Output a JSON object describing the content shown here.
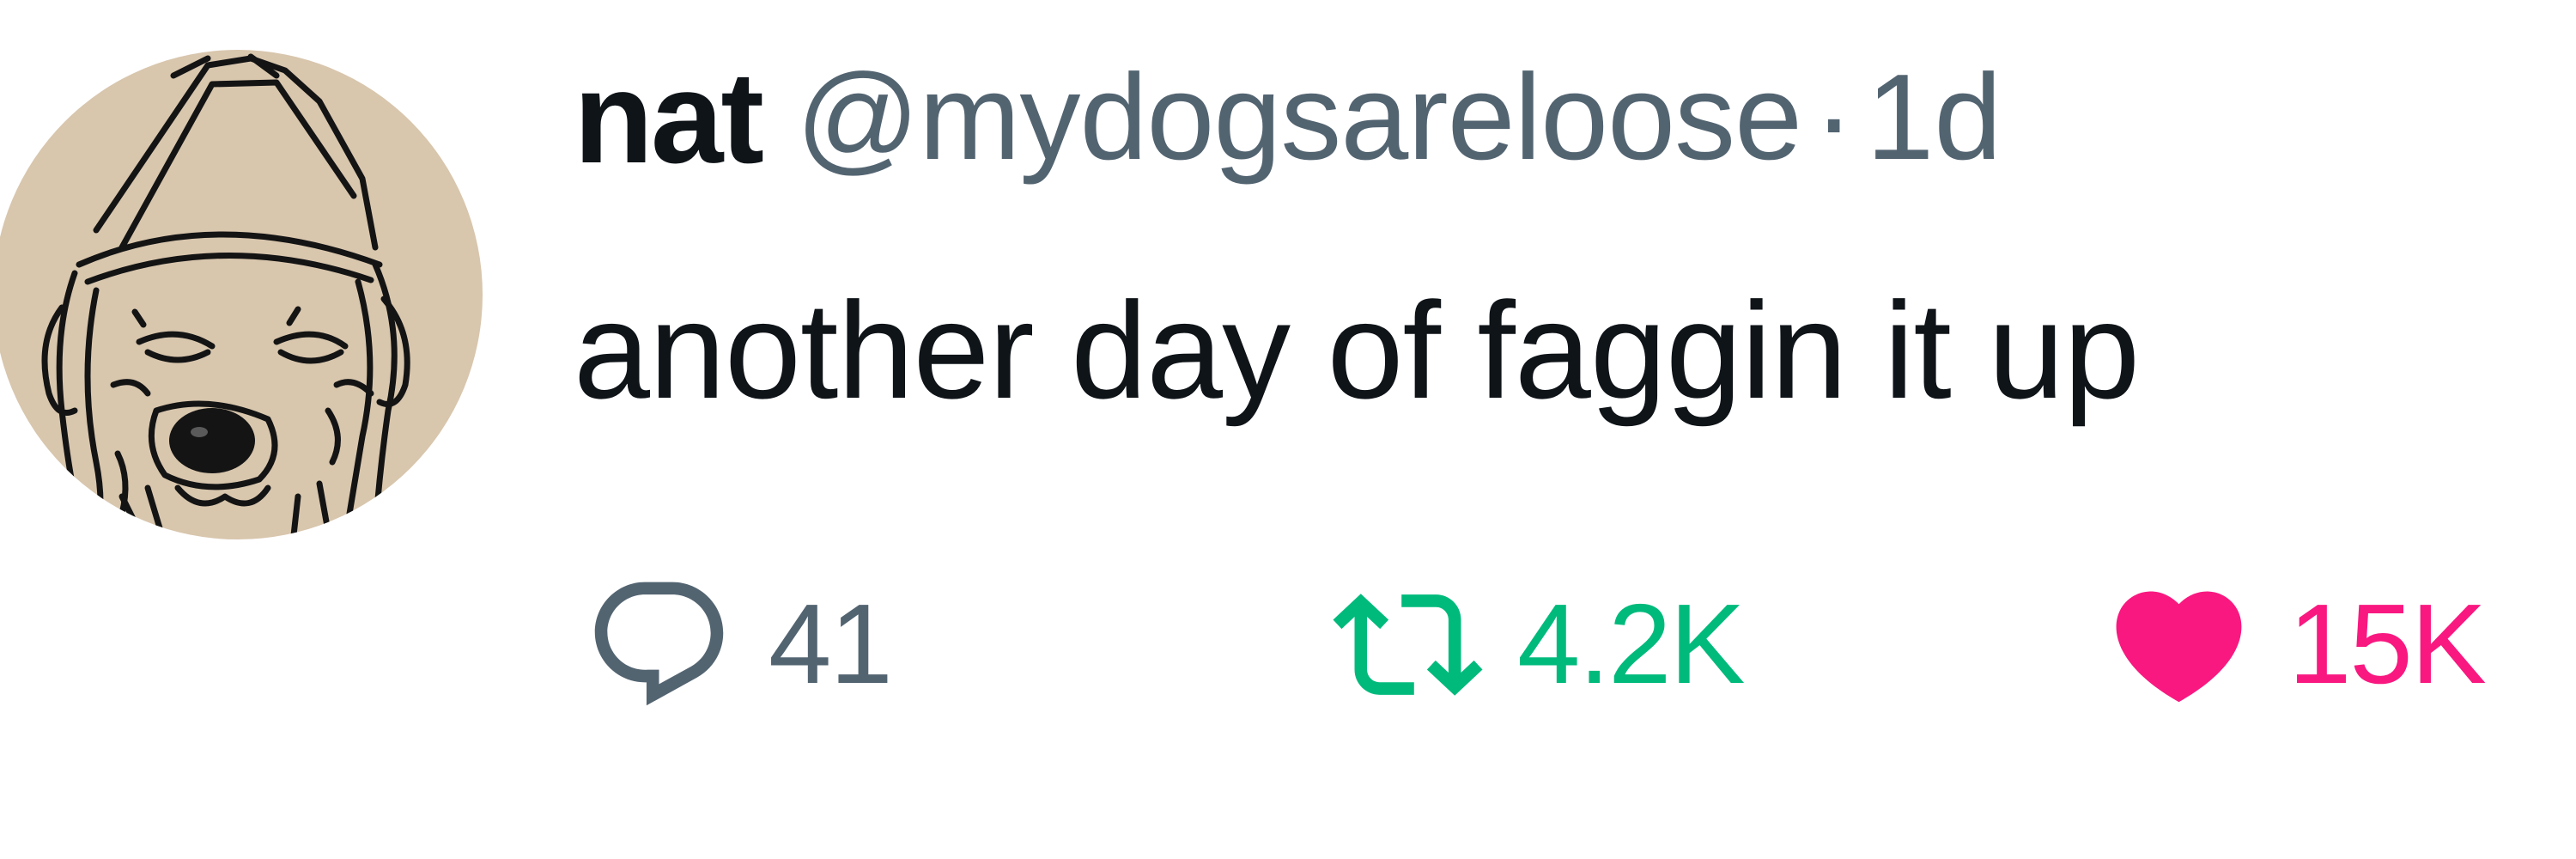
{
  "author": {
    "display_name": "nat",
    "handle": "@mydogsareloose",
    "separator": "·",
    "timestamp": "1d"
  },
  "tweet": {
    "text": "another day of faggin it up"
  },
  "actions": {
    "reply": {
      "icon": "reply-icon",
      "count": "41"
    },
    "retweet": {
      "icon": "retweet-icon",
      "count": "4.2K",
      "active": true
    },
    "like": {
      "icon": "heart-icon",
      "count": "15K",
      "active": true
    }
  },
  "colors": {
    "text_primary": "#0f1419",
    "text_secondary": "#536471",
    "retweet_active": "#00ba7c",
    "like_active": "#f91880",
    "avatar_bg": "#d8c6ad"
  }
}
